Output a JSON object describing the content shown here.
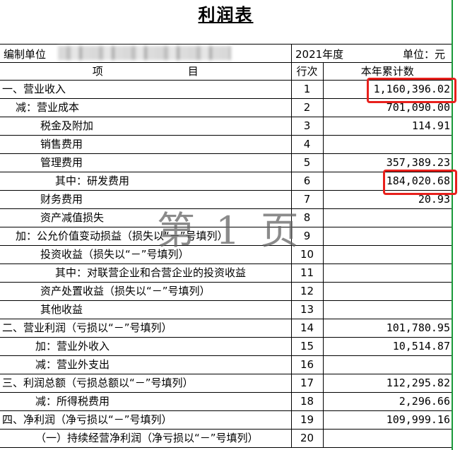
{
  "title": "利润表",
  "info": {
    "unit_label": "编制单位",
    "period": "2021年度",
    "currency": "单位：元"
  },
  "headers": {
    "item_a": "项",
    "item_b": "目",
    "row_no": "行次",
    "amount": "本年累计数"
  },
  "rows": [
    {
      "item": "一、营业收入",
      "row": "1",
      "amount": "1,160,396.02"
    },
    {
      "item": "减：营业成本",
      "row": "2",
      "amount": "701,090.00"
    },
    {
      "item": "税金及附加",
      "row": "3",
      "amount": "114.91"
    },
    {
      "item": "销售费用",
      "row": "4",
      "amount": ""
    },
    {
      "item": "管理费用",
      "row": "5",
      "amount": "357,389.23"
    },
    {
      "item": "其中：研发费用",
      "row": "6",
      "amount": "184,020.68"
    },
    {
      "item": "财务费用",
      "row": "7",
      "amount": "20.93"
    },
    {
      "item": "资产减值损失",
      "row": "8",
      "amount": ""
    },
    {
      "item": "加：公允价值变动损益（损失以“－”号填列）",
      "row": "9",
      "amount": ""
    },
    {
      "item": "投资收益（损失以“－”号填列）",
      "row": "10",
      "amount": ""
    },
    {
      "item": "其中：对联营企业和合营企业的投资收益",
      "row": "11",
      "amount": ""
    },
    {
      "item": "资产处置收益（损失以“－”号填列）",
      "row": "12",
      "amount": ""
    },
    {
      "item": "其他收益",
      "row": "13",
      "amount": ""
    },
    {
      "item": "二、营业利润（亏损以“－”号填列）",
      "row": "14",
      "amount": "101,780.95"
    },
    {
      "item": "加：营业外收入",
      "row": "15",
      "amount": "10,514.87"
    },
    {
      "item": "减：营业外支出",
      "row": "16",
      "amount": ""
    },
    {
      "item": "三、利润总额（亏损总额以“－”号填列）",
      "row": "17",
      "amount": "112,295.82"
    },
    {
      "item": "减：所得税费用",
      "row": "18",
      "amount": "2,296.66"
    },
    {
      "item": "四、净利润（净亏损以“－”号填列）",
      "row": "19",
      "amount": "109,999.16"
    },
    {
      "item": "（一）持续经营净利润（净亏损以“－”号填列）",
      "row": "20",
      "amount": ""
    }
  ],
  "watermark": "第 1 页",
  "highlight_color": "#e8201c",
  "grid_accent_color": "#1a9a3a"
}
